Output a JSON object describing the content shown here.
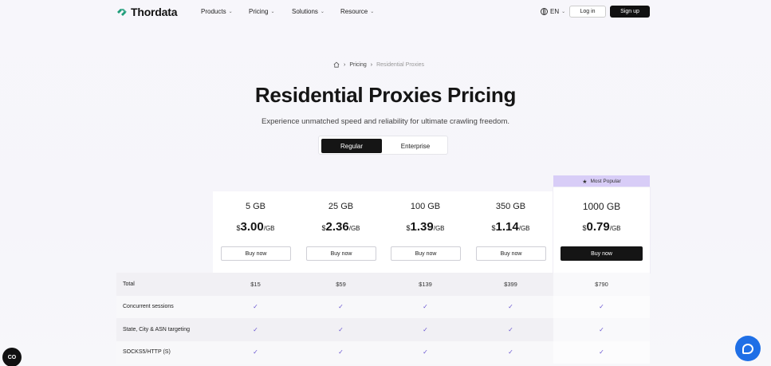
{
  "header": {
    "logo_text": "Thordata",
    "nav": [
      {
        "label": "Products"
      },
      {
        "label": "Pricing"
      },
      {
        "label": "Solutions"
      },
      {
        "label": "Resource"
      }
    ],
    "language": "EN",
    "login_label": "Log in",
    "signup_label": "Sign up"
  },
  "breadcrumb": {
    "items": [
      "Pricing",
      "Residential Proxies"
    ]
  },
  "page": {
    "title": "Residential Proxies Pricing",
    "subtitle": "Experience unmatched speed and reliability for ultimate crawling freedom."
  },
  "toggle": {
    "regular": "Regular",
    "enterprise": "Enterprise",
    "selected": "Regular"
  },
  "popular_badge": "Most Popular",
  "plans": [
    {
      "size": "5 GB",
      "currency": "$",
      "amount": "3.00",
      "unit": "/GB",
      "buy": "Buy now"
    },
    {
      "size": "25 GB",
      "currency": "$",
      "amount": "2.36",
      "unit": "/GB",
      "buy": "Buy now"
    },
    {
      "size": "100 GB",
      "currency": "$",
      "amount": "1.39",
      "unit": "/GB",
      "buy": "Buy now"
    },
    {
      "size": "350 GB",
      "currency": "$",
      "amount": "1.14",
      "unit": "/GB",
      "buy": "Buy now"
    },
    {
      "size": "1000 GB",
      "currency": "$",
      "amount": "0.79",
      "unit": "/GB",
      "buy": "Buy now"
    }
  ],
  "table": {
    "rows": [
      {
        "label": "Total",
        "values": [
          "$15",
          "$59",
          "$139",
          "$399",
          "$790"
        ]
      },
      {
        "label": "Concurrent sessions",
        "values": [
          "✓",
          "✓",
          "✓",
          "✓",
          "✓"
        ]
      },
      {
        "label": "State, City & ASN targeting",
        "values": [
          "✓",
          "✓",
          "✓",
          "✓",
          "✓"
        ]
      },
      {
        "label": "SOCKS5/HTTP (S)",
        "values": [
          "✓",
          "✓",
          "✓",
          "✓",
          "✓"
        ]
      }
    ]
  },
  "floating": {
    "cookie_label": "CO"
  },
  "colors": {
    "accent": "#6b57d1",
    "badge_bg": "#d8cdf7",
    "chat_button": "#1f6fe6",
    "dark": "#151515",
    "logo_green": "#1f9d7a"
  },
  "icons": {
    "logo": "thordata-logo-icon",
    "globe": "globe-icon",
    "home": "home-icon",
    "star": "star-icon",
    "check": "check-icon",
    "chat": "chat-icon"
  }
}
